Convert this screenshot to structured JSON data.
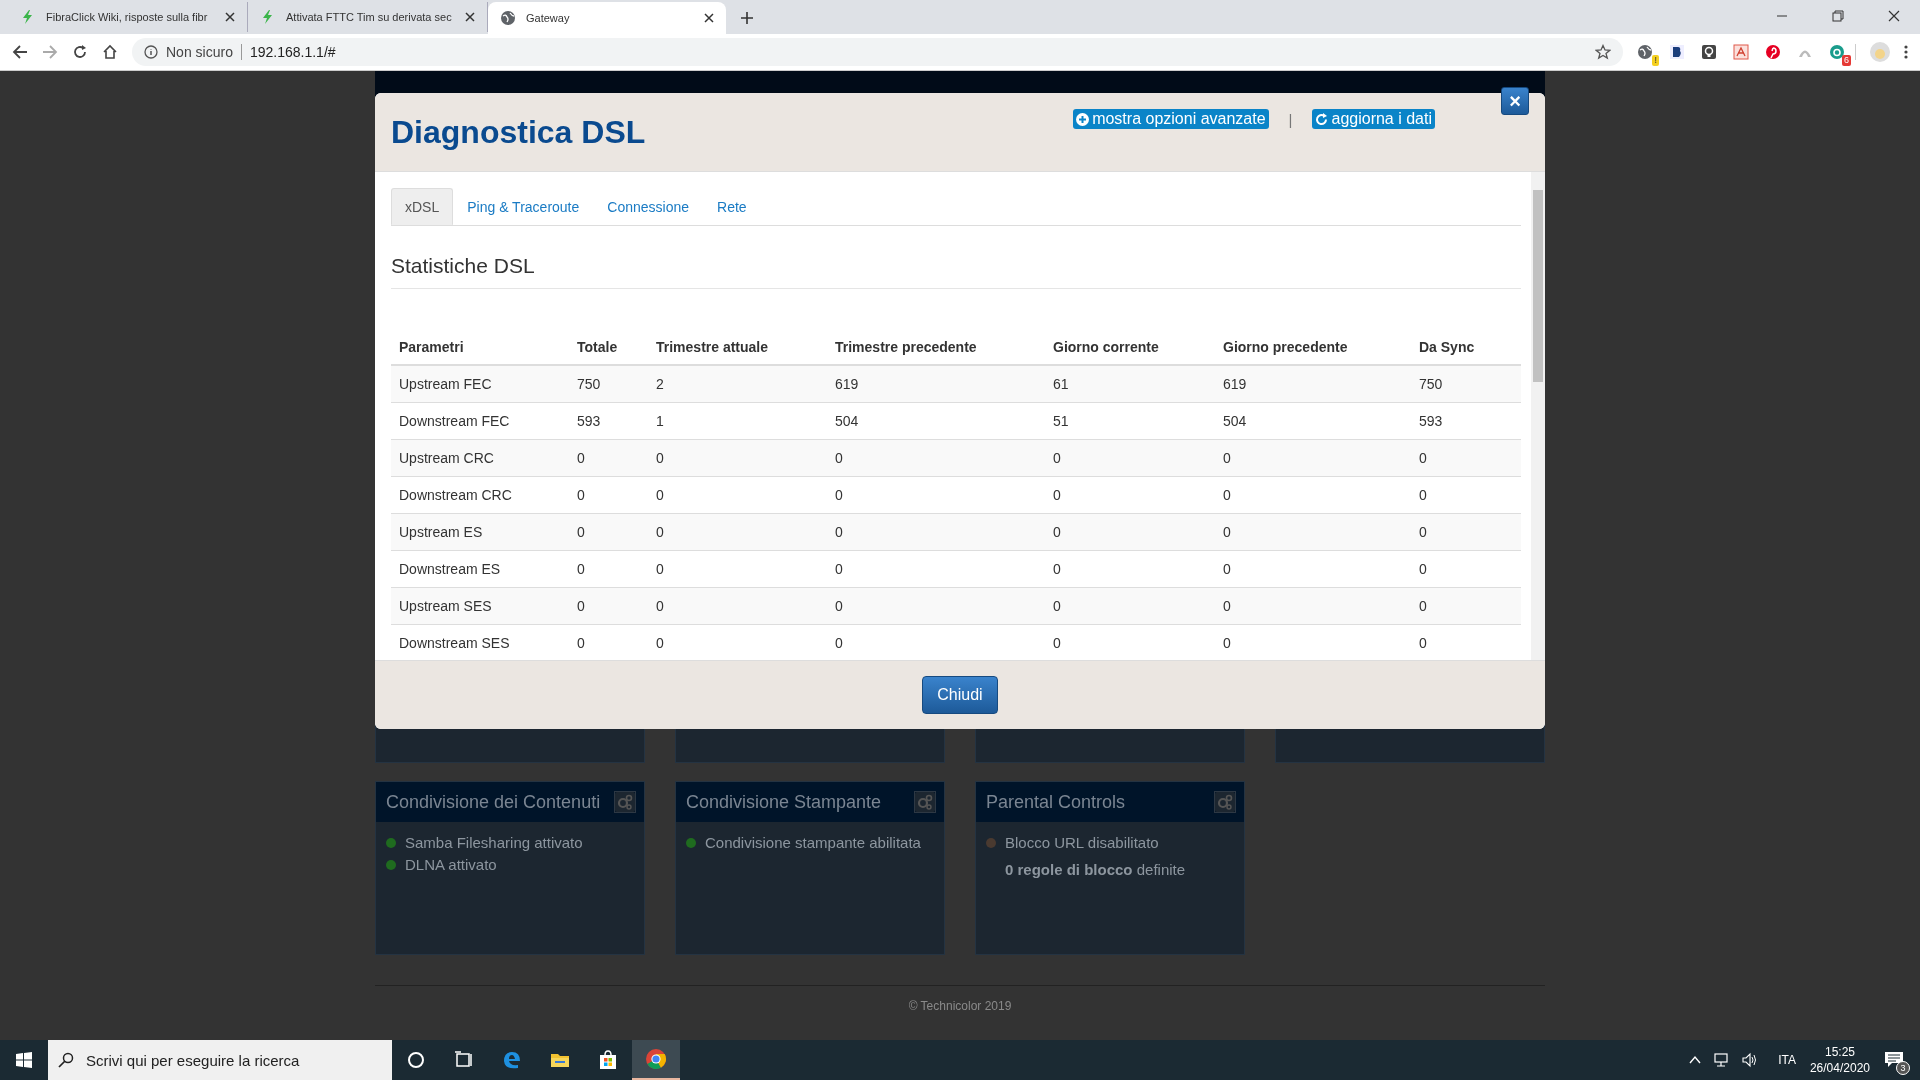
{
  "browser": {
    "tabs": [
      {
        "title": "FibraClick Wiki, risposte sulla fibr",
        "selected": false
      },
      {
        "title": "Attivata FTTC Tim su derivata sec",
        "selected": false
      },
      {
        "title": "Gateway",
        "selected": true
      }
    ],
    "security": "Non sicuro",
    "url": "192.168.1.1/#",
    "extension_badges": [
      "!",
      "6"
    ]
  },
  "dashboard": {
    "cards": [
      {
        "title": "Condivisione dei Contenuti",
        "lines": [
          {
            "kind": "status",
            "text": "Samba Filesharing attivato",
            "color": "#1f6b1f"
          },
          {
            "kind": "status",
            "text": "DLNA attivato",
            "color": "#1f6b1f"
          }
        ]
      },
      {
        "title": "Condivisione Stampante",
        "lines": [
          {
            "kind": "status",
            "text": "Condivisione stampante abilitata",
            "color": "#1f6b1f"
          }
        ]
      },
      {
        "title": "Parental Controls",
        "lines": [
          {
            "kind": "status",
            "text": "Blocco URL disabilitato",
            "color": "#4a3a30"
          },
          {
            "kind": "note",
            "text": "**0 regole di blocco** definite"
          }
        ]
      }
    ],
    "footer": "© Technicolor 2019"
  },
  "modal": {
    "title": "Diagnostica DSL",
    "actions": [
      {
        "label": "mostra opzioni avanzate"
      },
      {
        "label": "aggiorna i dati"
      }
    ],
    "separator": "|",
    "close": "×",
    "tabs": [
      {
        "label": "xDSL",
        "selected": true
      },
      {
        "label": "Ping & Traceroute",
        "selected": false
      },
      {
        "label": "Connessione",
        "selected": false
      },
      {
        "label": "Rete",
        "selected": false
      }
    ],
    "section_title": "Statistiche DSL",
    "table": {
      "columns": [
        "Parametri",
        "Totale",
        "Trimestre attuale",
        "Trimestre precedente",
        "Giorno corrente",
        "Giorno precedente",
        "Da Sync"
      ],
      "rows": [
        [
          "Upstream FEC",
          "750",
          "2",
          "619",
          "61",
          "619",
          "750"
        ],
        [
          "Downstream FEC",
          "593",
          "1",
          "504",
          "51",
          "504",
          "593"
        ],
        [
          "Upstream CRC",
          "0",
          "0",
          "0",
          "0",
          "0",
          "0"
        ],
        [
          "Downstream CRC",
          "0",
          "0",
          "0",
          "0",
          "0",
          "0"
        ],
        [
          "Upstream ES",
          "0",
          "0",
          "0",
          "0",
          "0",
          "0"
        ],
        [
          "Downstream ES",
          "0",
          "0",
          "0",
          "0",
          "0",
          "0"
        ],
        [
          "Upstream SES",
          "0",
          "0",
          "0",
          "0",
          "0",
          "0"
        ],
        [
          "Downstream SES",
          "0",
          "0",
          "0",
          "0",
          "0",
          "0"
        ]
      ]
    },
    "button": "Chiudi"
  },
  "taskbar": {
    "search_placeholder": "Scrivi qui per eseguire la ricerca",
    "apps": [
      {
        "selected": false
      },
      {
        "selected": false
      },
      {
        "selected": false
      },
      {
        "selected": false
      },
      {
        "selected": false
      },
      {
        "selected": true
      }
    ],
    "language": "ITA",
    "time": "15:25",
    "date": "26/04/2020",
    "notifications": "3"
  }
}
